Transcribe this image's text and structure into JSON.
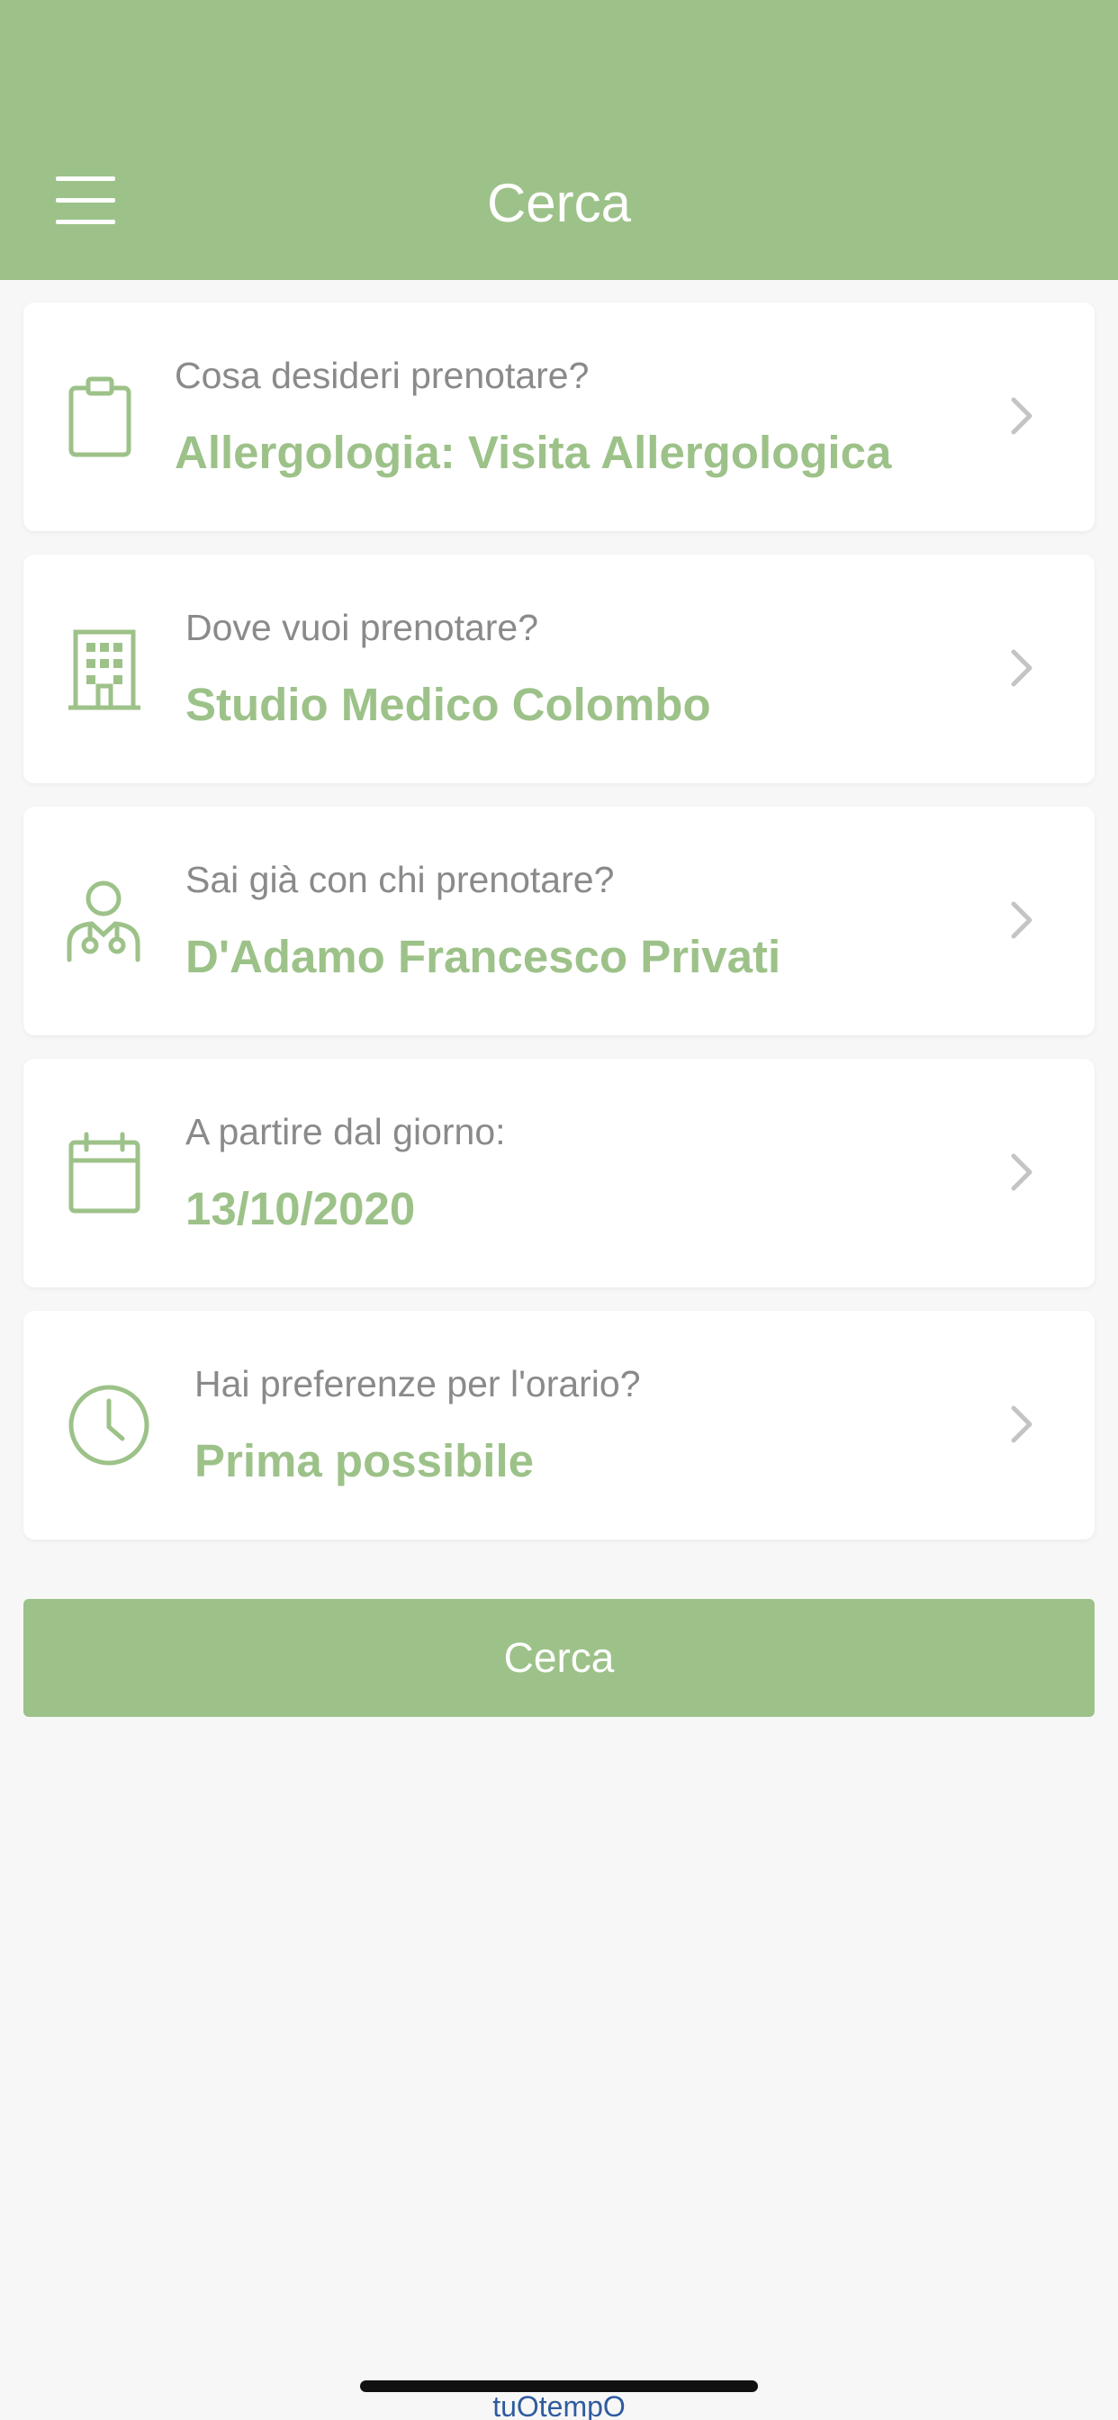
{
  "header": {
    "title": "Cerca",
    "menu_icon": "hamburger-menu-icon",
    "background": "#9dc289"
  },
  "fields": [
    {
      "icon": "clipboard-icon",
      "label": "Cosa desideri prenotare?",
      "value": "Allergologia: Visita Allergologica"
    },
    {
      "icon": "building-icon",
      "label": "Dove vuoi prenotare?",
      "value": "Studio Medico Colombo"
    },
    {
      "icon": "doctor-icon",
      "label": "Sai già con chi prenotare?",
      "value": "D'Adamo Francesco Privati"
    },
    {
      "icon": "calendar-icon",
      "label": "A partire dal giorno:",
      "value": "13/10/2020"
    },
    {
      "icon": "clock-icon",
      "label": "Hai preferenze per l'orario?",
      "value": "Prima possibile"
    }
  ],
  "search_button": {
    "label": "Cerca"
  },
  "footer": {
    "watermark": "tuOtempO"
  },
  "colors": {
    "accent": "#9dc289",
    "label_text": "#8a8a8a",
    "page_background": "#f7f7f7"
  }
}
